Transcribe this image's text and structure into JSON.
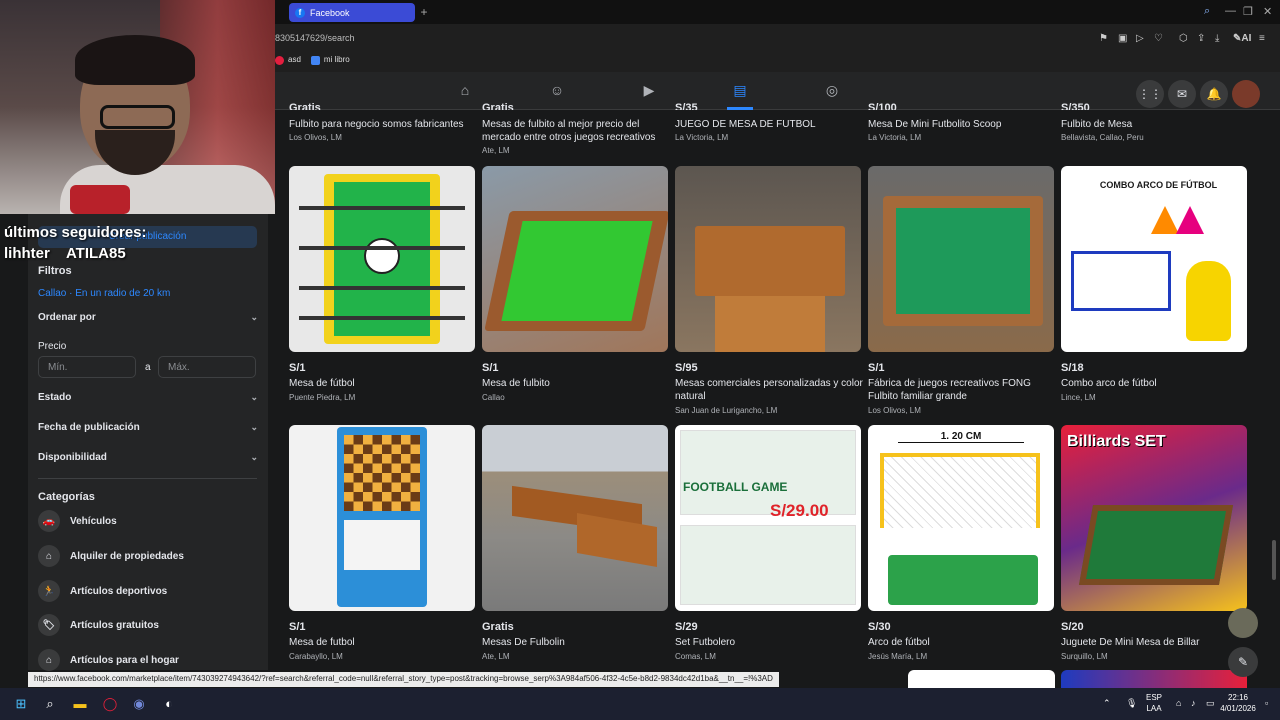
{
  "browser": {
    "tab_title": "Facebook",
    "url": "8305147629/search",
    "bookmarks": [
      {
        "label": "asd",
        "color": "#e41e3f"
      },
      {
        "label": "mi libro",
        "color": "#4285f4"
      }
    ],
    "ai_label": "AI"
  },
  "overlay": {
    "line1": "últimos seguidores:",
    "line2": "lihhter    ATILA85"
  },
  "sidebar": {
    "create_button": "Crear publicación",
    "filters_heading": "Filtros",
    "location": "Callao · En un radio de 20 km",
    "sort_label": "Ordenar por",
    "price_label": "Precio",
    "price_min_placeholder": "Mín.",
    "price_sep": "a",
    "price_max_placeholder": "Máx.",
    "condition_label": "Estado",
    "date_label": "Fecha de publicación",
    "availability_label": "Disponibilidad",
    "categories_heading": "Categorías",
    "categories": [
      {
        "label": "Vehículos",
        "icon": "car-icon"
      },
      {
        "label": "Alquiler de propiedades",
        "icon": "home-icon"
      },
      {
        "label": "Artículos deportivos",
        "icon": "running-icon"
      },
      {
        "label": "Artículos gratuitos",
        "icon": "tag-icon"
      },
      {
        "label": "Artículos para el hogar",
        "icon": "house-icon"
      }
    ]
  },
  "top_row": [
    {
      "price": "Gratis",
      "title": "Fulbito para negocio somos fabricantes",
      "location": "Los Olivos, LM"
    },
    {
      "price": "Gratis",
      "title": "Mesas de fulbito al mejor precio del mercado entre otros juegos recreativos",
      "location": "Ate, LM"
    },
    {
      "price": "S/35",
      "title": "JUEGO DE MESA DE FUTBOL",
      "location": "La Victoria, LM"
    },
    {
      "price": "S/100",
      "title": "Mesa De Mini Futbolito Scoop",
      "location": "La Victoria, LM"
    },
    {
      "price": "S/350",
      "title": "Fulbito de Mesa",
      "location": "Bellavista, Callao, Peru"
    }
  ],
  "row1": [
    {
      "price": "S/1",
      "title": "Mesa de fútbol",
      "location": "Puente Piedra, LM"
    },
    {
      "price": "S/1",
      "title": "Mesa de fulbito",
      "location": "Callao"
    },
    {
      "price": "S/95",
      "title": "Mesas comerciales personalizadas y color natural",
      "location": "San Juan de Lurigancho, LM"
    },
    {
      "price": "S/1",
      "title": "Fábrica de juegos recreativos FONG Fulbito familiar grande",
      "location": "Los Olivos, LM"
    },
    {
      "price": "S/18",
      "title": "Combo arco de fútbol",
      "location": "Lince, LM"
    }
  ],
  "row2": [
    {
      "price": "S/1",
      "title": "Mesa de futbol",
      "location": "Carabayllo, LM"
    },
    {
      "price": "Gratis",
      "title": "Mesas De Fulbolin",
      "location": "Ate, LM"
    },
    {
      "price": "S/29",
      "title": "Set Futbolero",
      "location": "Comas, LM"
    },
    {
      "price": "S/30",
      "title": "Arco de fútbol",
      "location": "Jesús María, LM"
    },
    {
      "price": "S/20",
      "title": "Juguete De Mini Mesa de Billar",
      "location": "Surquillo, LM"
    }
  ],
  "image_text": {
    "combo": "COMBO ARCO DE FÚTBOL",
    "set_price": "S/29.00",
    "football_game": "FOOTBALL GAME",
    "arco_size": "1. 20 CM",
    "billiards": "Billiards SET"
  },
  "status_url": "https://www.facebook.com/marketplace/item/743039274943642/?ref=search&referral_code=null&referral_story_type=post&tracking=browse_serp%3A984af506-4f32-4c5e-b8d2-9834dc42d1ba&__tn__=!%3AD",
  "taskbar": {
    "lang1": "ESP",
    "lang2": "LAA",
    "time": "22:16",
    "date": "4/01/2026"
  }
}
